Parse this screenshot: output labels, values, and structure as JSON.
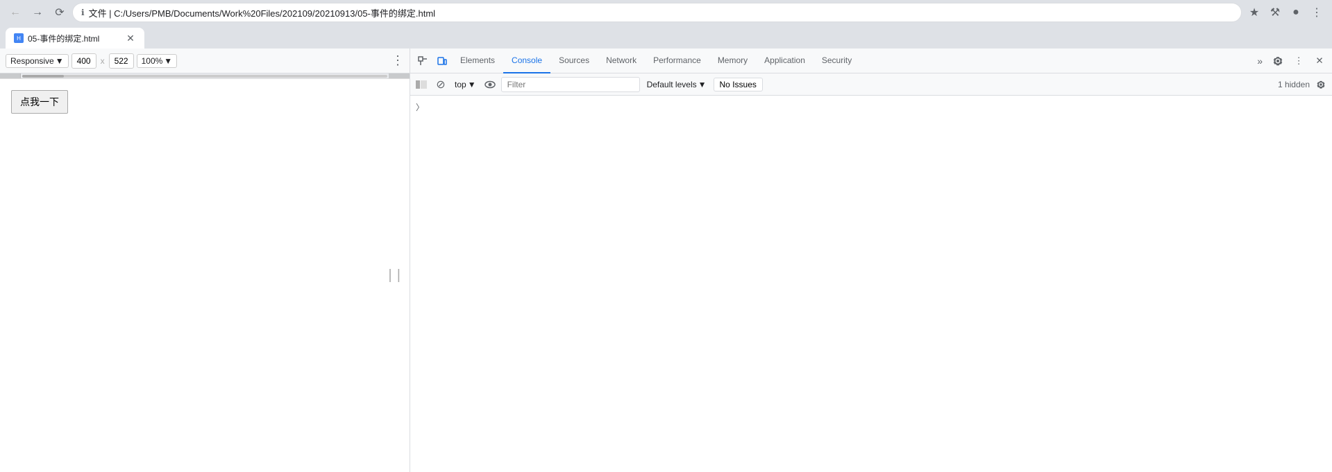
{
  "browser": {
    "url": "文件 | C:/Users/PMB/Documents/Work%20Files/202109/20210913/05-事件的绑定.html",
    "tab_title": "05-事件的绑定.html"
  },
  "responsive_toolbar": {
    "mode_label": "Responsive",
    "width_value": "400",
    "height_value": "522",
    "zoom_label": "100%",
    "more_icon": "⋮"
  },
  "page": {
    "button_label": "点我一下"
  },
  "devtools": {
    "tabs": [
      {
        "id": "elements",
        "label": "Elements",
        "active": false
      },
      {
        "id": "console",
        "label": "Console",
        "active": true
      },
      {
        "id": "sources",
        "label": "Sources",
        "active": false
      },
      {
        "id": "network",
        "label": "Network",
        "active": false
      },
      {
        "id": "performance",
        "label": "Performance",
        "active": false
      },
      {
        "id": "memory",
        "label": "Memory",
        "active": false
      },
      {
        "id": "application",
        "label": "Application",
        "active": false
      },
      {
        "id": "security",
        "label": "Security",
        "active": false
      }
    ],
    "console": {
      "context": "top",
      "filter_placeholder": "Filter",
      "levels_label": "Default levels",
      "no_issues_label": "No Issues",
      "hidden_count": "1 hidden"
    }
  }
}
